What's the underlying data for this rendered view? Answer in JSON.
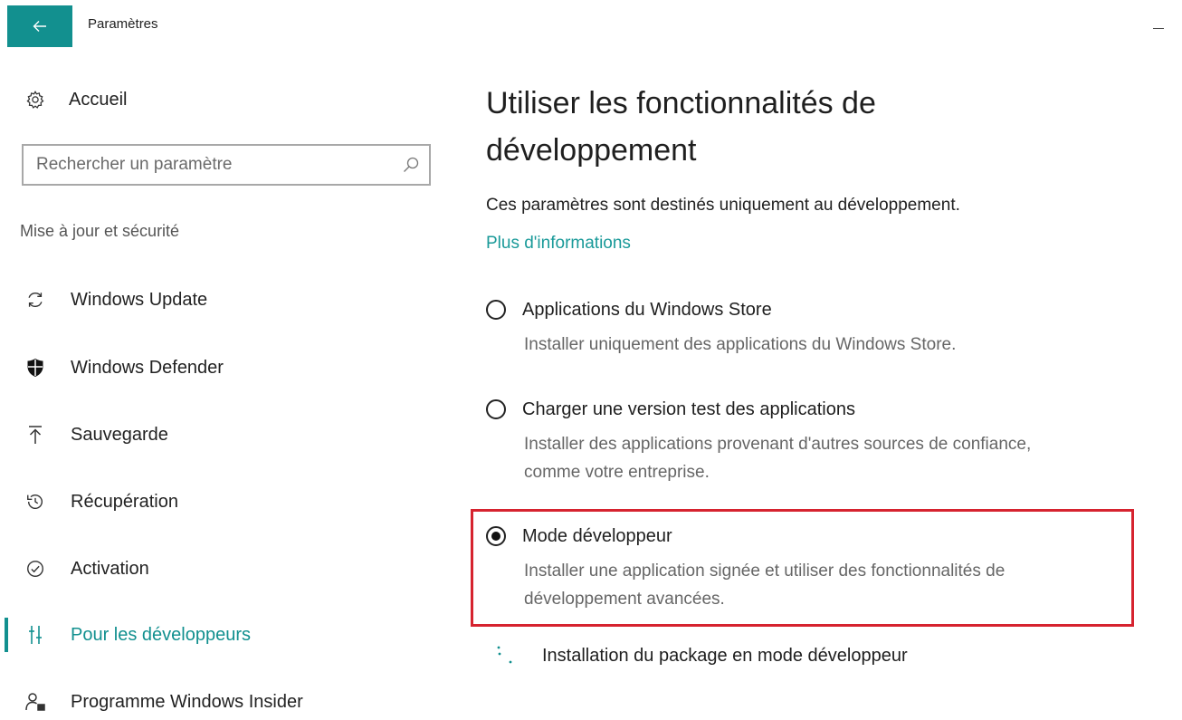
{
  "window": {
    "title": "Paramètres",
    "accent_color": "#12908f",
    "highlight_color": "#d6232f"
  },
  "titlebar": {
    "back_icon": "arrow-left-icon",
    "minimize_icon": "minimize-icon"
  },
  "sidebar": {
    "home": {
      "label": "Accueil",
      "icon": "gear-icon"
    },
    "search": {
      "placeholder": "Rechercher un paramètre",
      "value": "",
      "icon": "search-icon"
    },
    "section_header": "Mise à jour et sécurité",
    "items": [
      {
        "label": "Windows Update",
        "icon": "refresh-icon",
        "active": false
      },
      {
        "label": "Windows Defender",
        "icon": "shield-icon",
        "active": false
      },
      {
        "label": "Sauvegarde",
        "icon": "backup-upload-icon",
        "active": false
      },
      {
        "label": "Récupération",
        "icon": "history-icon",
        "active": false
      },
      {
        "label": "Activation",
        "icon": "check-circle-icon",
        "active": false
      },
      {
        "label": "Pour les développeurs",
        "icon": "developer-tools-icon",
        "active": true
      },
      {
        "label": "Programme Windows Insider",
        "icon": "insider-person-icon",
        "active": false
      }
    ]
  },
  "main": {
    "title": "Utiliser les fonctionnalités de développement",
    "description": "Ces paramètres sont destinés uniquement au développement.",
    "more_link": "Plus d'informations",
    "options": [
      {
        "label": "Applications du Windows Store",
        "description": "Installer uniquement des applications du Windows Store.",
        "checked": false
      },
      {
        "label": "Charger une version test des applications",
        "description": "Installer des applications provenant d'autres sources de confiance, comme votre entreprise.",
        "checked": false
      },
      {
        "label": "Mode développeur",
        "description": "Installer une application signée et utiliser des fonctionnalités de développement avancées.",
        "checked": true
      }
    ],
    "package_status": {
      "label": "Installation du package en mode développeur",
      "icon": "loading-spinner-icon"
    }
  }
}
